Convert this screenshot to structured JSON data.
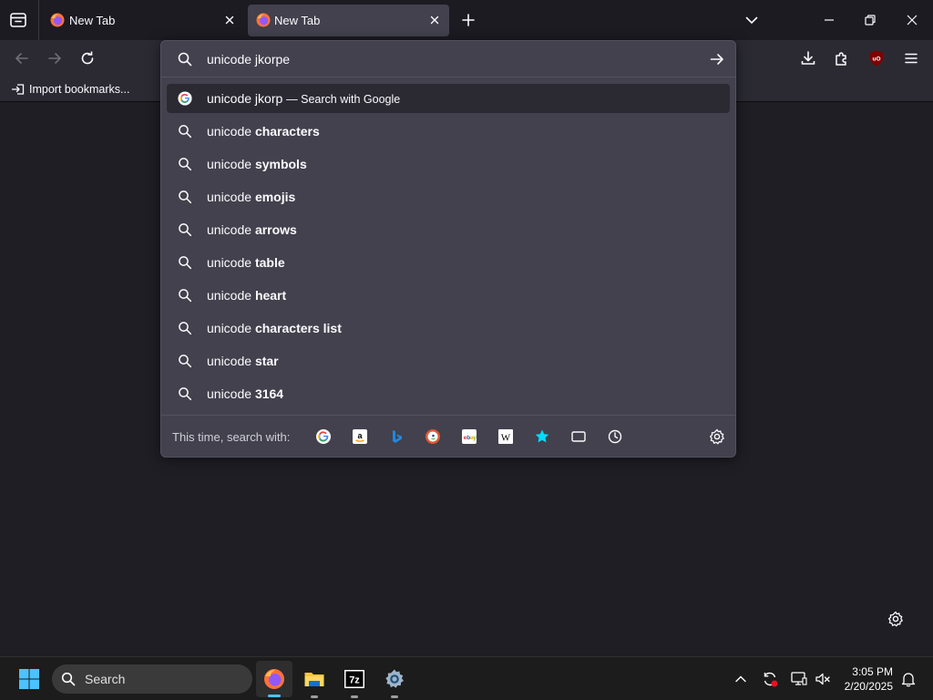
{
  "tabs": [
    {
      "label": "New Tab",
      "active": false
    },
    {
      "label": "New Tab",
      "active": true
    }
  ],
  "bookmarks": {
    "import_label": "Import bookmarks..."
  },
  "urlbar": {
    "value": "unicode jkorpe",
    "suggestions": [
      {
        "prefix": "unicode jkorp",
        "bold": "",
        "note": "— Search with Google",
        "icon": "google-icon",
        "active": true
      },
      {
        "prefix": "unicode ",
        "bold": "characters",
        "note": "",
        "icon": "search-icon",
        "active": false
      },
      {
        "prefix": "unicode ",
        "bold": "symbols",
        "note": "",
        "icon": "search-icon",
        "active": false
      },
      {
        "prefix": "unicode ",
        "bold": "emojis",
        "note": "",
        "icon": "search-icon",
        "active": false
      },
      {
        "prefix": "unicode ",
        "bold": "arrows",
        "note": "",
        "icon": "search-icon",
        "active": false
      },
      {
        "prefix": "unicode ",
        "bold": "table",
        "note": "",
        "icon": "search-icon",
        "active": false
      },
      {
        "prefix": "unicode ",
        "bold": "heart",
        "note": "",
        "icon": "search-icon",
        "active": false
      },
      {
        "prefix": "unicode ",
        "bold": "characters list",
        "note": "",
        "icon": "search-icon",
        "active": false
      },
      {
        "prefix": "unicode ",
        "bold": "star",
        "note": "",
        "icon": "search-icon",
        "active": false
      },
      {
        "prefix": "unicode ",
        "bold": "3164",
        "note": "",
        "icon": "search-icon",
        "active": false
      }
    ],
    "oneoff_label": "This time, search with:",
    "engines": [
      "google-icon",
      "amazon-icon",
      "bing-icon",
      "duckduckgo-icon",
      "ebay-icon",
      "wikipedia-icon",
      "bookmarks-star-icon",
      "tabs-icon",
      "history-clock-icon"
    ]
  },
  "taskbar": {
    "search_label": "Search",
    "time": "3:05 PM",
    "date": "2/20/2025",
    "apps": [
      "firefox-icon",
      "file-explorer-icon",
      "7zip-icon",
      "settings-gear-icon"
    ]
  },
  "colors": {
    "accent": "#00ddff",
    "popup_bg": "#42414d",
    "toolbar_bg": "#2b2a33",
    "page_bg": "#1f1e25"
  }
}
